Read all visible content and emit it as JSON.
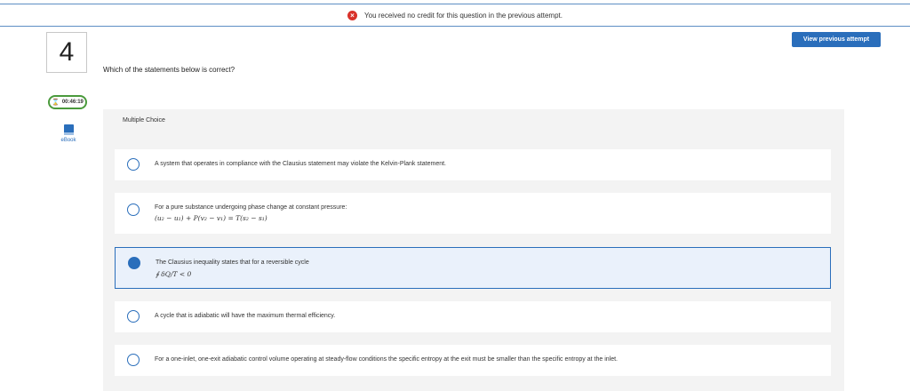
{
  "banner": {
    "icon": "error-icon",
    "message": "You received no credit for this question in the previous attempt."
  },
  "header": {
    "view_previous_label": "View previous attempt"
  },
  "sidebar": {
    "question_number": "4",
    "timer": "00:46:19",
    "ebook_label": "eBook"
  },
  "question": {
    "text": "Which of the statements below is correct?"
  },
  "mc": {
    "title": "Multiple Choice",
    "options": [
      {
        "text": "A system that operates in compliance with the Clausius statement may violate the Kelvin-Plank statement.",
        "selected": false
      },
      {
        "text": "For a pure substance undergoing phase change at constant pressure:",
        "formula": "(u₂ − u₁) + P(v₂ − v₁) = T(s₂ − s₁)",
        "selected": false
      },
      {
        "text": "The Clausius inequality states that for a reversible cycle",
        "formula": "∮ δQ/T < 0",
        "selected": true
      },
      {
        "text": "A cycle that is adiabatic will have the maximum thermal efficiency.",
        "selected": false
      },
      {
        "text": "For a one-inlet, one-exit adiabatic control volume operating at steady-flow conditions the specific entropy at the exit must be smaller than the specific entropy at the inlet.",
        "selected": false
      }
    ]
  },
  "colors": {
    "accent": "#2a6ebb",
    "timer_green": "#4a9a3c",
    "error_red": "#d9322a",
    "panel_bg": "#f3f3f3",
    "selected_bg": "#eaf1fb"
  }
}
